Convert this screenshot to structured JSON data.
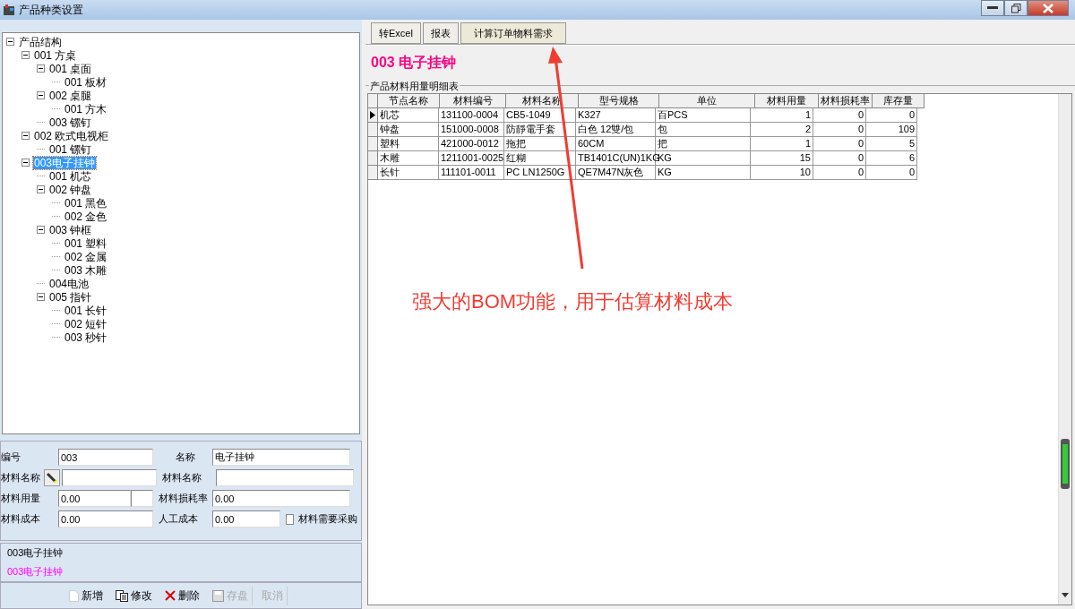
{
  "window": {
    "title": "产品种类设置"
  },
  "tree": [
    {
      "label": "产品结构",
      "expanded": true,
      "selected": false,
      "children": [
        {
          "label": "001 方桌",
          "expanded": true,
          "selected": false,
          "children": [
            {
              "label": "001 桌面",
              "expanded": true,
              "selected": false,
              "children": [
                {
                  "label": "001 板材",
                  "selected": false
                }
              ]
            },
            {
              "label": "002 桌腿",
              "expanded": true,
              "selected": false,
              "children": [
                {
                  "label": "001 方木",
                  "selected": false
                }
              ]
            },
            {
              "label": "003 镙钉",
              "selected": false
            }
          ]
        },
        {
          "label": "002 欧式电视柜",
          "expanded": true,
          "selected": false,
          "children": [
            {
              "label": "001 镙钉",
              "selected": false
            }
          ]
        },
        {
          "label": "003电子挂钟",
          "expanded": true,
          "selected": true,
          "children": [
            {
              "label": "001 机芯",
              "selected": false
            },
            {
              "label": "002 钟盘",
              "expanded": true,
              "selected": false,
              "children": [
                {
                  "label": "001 黑色",
                  "selected": false
                },
                {
                  "label": "002 金色",
                  "selected": false
                }
              ]
            },
            {
              "label": "003 钟框",
              "expanded": true,
              "selected": false,
              "children": [
                {
                  "label": "001 塑料",
                  "selected": false
                },
                {
                  "label": "002 金属",
                  "selected": false
                },
                {
                  "label": "003 木雕",
                  "selected": false
                }
              ]
            },
            {
              "label": "004电池",
              "selected": false
            },
            {
              "label": "005 指针",
              "expanded": true,
              "selected": false,
              "children": [
                {
                  "label": "001 长针",
                  "selected": false
                },
                {
                  "label": "002 短针",
                  "selected": false
                },
                {
                  "label": "003 秒针",
                  "selected": false
                }
              ]
            }
          ]
        }
      ]
    }
  ],
  "form": {
    "code_label": "编号",
    "code": "003",
    "name_label": "名称",
    "name": "电子挂钟",
    "material_label": "材料名称",
    "material_label_2": "材料名称",
    "usage_label": "材料用量",
    "usage": "0.00",
    "loss_label": "材料损耗率",
    "loss": "0.00",
    "cost_label": "材料成本",
    "cost": "0.00",
    "labor_label": "人工成本",
    "labor": "0.00",
    "purchase": {
      "label": "材料需要采购",
      "checked": false
    }
  },
  "status_lines": [
    {
      "text": "003电子挂钟",
      "kind": "plain"
    },
    {
      "text": "003电子挂钟",
      "kind": "highlight"
    }
  ],
  "actions": [
    {
      "label": "新增",
      "kind": "new",
      "disabled": false
    },
    {
      "label": "修改",
      "kind": "edit",
      "disabled": false
    },
    {
      "label": "删除",
      "kind": "delete",
      "disabled": false
    },
    {
      "label": "存盘",
      "kind": "save",
      "disabled": true
    },
    {
      "label": "取消",
      "kind": "cancel",
      "disabled": true
    }
  ],
  "toolbar": [
    "转Excel",
    "报表",
    "计算订单物料需求"
  ],
  "product_title": "003 电子挂钟",
  "table": {
    "title": "产品材料用量明细表",
    "columns": [
      "节点名称",
      "材料编号",
      "材料名称",
      "型号规格",
      "单位",
      "材料用量",
      "材料损耗率",
      "库存量"
    ],
    "rows": [
      {
        "selected": true,
        "cells": [
          "机芯",
          "131100-0004",
          "CB5-1049",
          "K327",
          "百PCS",
          "1",
          "0",
          "0"
        ]
      },
      {
        "selected": false,
        "cells": [
          "钟盘",
          "151000-0008",
          "防靜電手套",
          "白色 12雙/包",
          "包",
          "2",
          "0",
          "109"
        ]
      },
      {
        "selected": false,
        "cells": [
          "塑料",
          "421000-0012",
          "拖把",
          "60CM",
          "把",
          "1",
          "0",
          "5"
        ]
      },
      {
        "selected": false,
        "cells": [
          "木雕",
          "1211001-0025",
          "红糊",
          "TB1401C(UN)1KG",
          "KG",
          "15",
          "0",
          "6"
        ]
      },
      {
        "selected": false,
        "cells": [
          "长针",
          "111101-0011",
          "PC LN1250G",
          "QE7M47N灰色",
          "KG",
          "10",
          "0",
          "0"
        ]
      }
    ]
  },
  "annotation": "强大的BOM功能，用于估算材料成本"
}
